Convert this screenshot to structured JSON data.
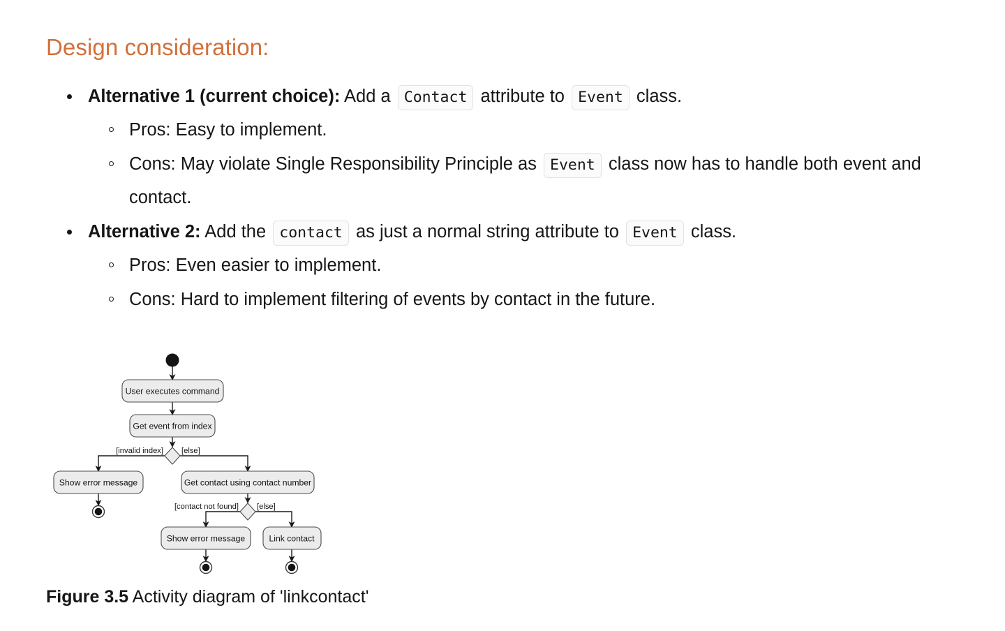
{
  "heading": "Design consideration:",
  "alternatives": [
    {
      "lead": "Alternative 1 (current choice):",
      "text_1": "Add a",
      "code_1": "Contact",
      "text_2": "attribute to",
      "code_2": "Event",
      "text_3": "class.",
      "sub": [
        {
          "text_1": "Pros: Easy to implement.",
          "code_1": "",
          "text_2": ""
        },
        {
          "text_1": "Cons: May violate Single Responsibility Principle as",
          "code_1": "Event",
          "text_2": "class now has to handle both event and contact."
        }
      ]
    },
    {
      "lead": "Alternative 2:",
      "text_1": "Add the",
      "code_1": "contact",
      "text_2": "as just a normal string attribute to",
      "code_2": "Event",
      "text_3": "class.",
      "sub": [
        {
          "text_1": "Pros: Even easier to implement.",
          "code_1": "",
          "text_2": ""
        },
        {
          "text_1": "Cons: Hard to implement filtering of events by contact in the future.",
          "code_1": "",
          "text_2": ""
        }
      ]
    }
  ],
  "diagram": {
    "nodes": {
      "user_executes_command": "User executes command",
      "get_event_from_index": "Get event from index",
      "show_error_message_1": "Show error message",
      "get_contact_using_contact_number": "Get contact using contact number",
      "show_error_message_2": "Show error message",
      "link_contact": "Link contact"
    },
    "guards": {
      "invalid_index": "[invalid index]",
      "else_1": "[else]",
      "contact_not_found": "[contact not found]",
      "else_2": "[else]"
    },
    "colors": {
      "node_fill": "#ececec",
      "node_stroke": "#4c4c4c",
      "edge_stroke": "#1a1a1a",
      "terminal_fill": "#141414"
    }
  },
  "figure": {
    "label": "Figure 3.5",
    "caption": " Activity diagram of 'linkcontact'"
  }
}
